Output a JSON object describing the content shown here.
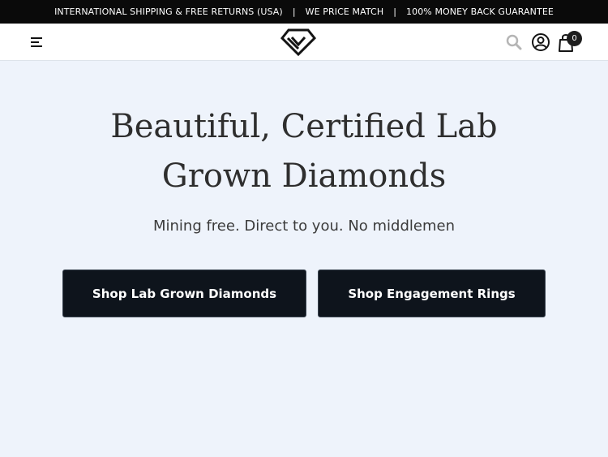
{
  "announcement": {
    "items": [
      "INTERNATIONAL SHIPPING & FREE RETURNS (USA)",
      "WE PRICE MATCH",
      "100% MONEY BACK GUARANTEE"
    ],
    "separator": "|"
  },
  "header": {
    "menu_icon": "hamburger-menu-icon",
    "logo_icon": "diamond-logo-icon",
    "search_icon": "search-icon",
    "account_icon": "account-user-icon",
    "cart_icon": "shopping-bag-icon",
    "cart_count": "0"
  },
  "hero": {
    "title_line1": "Beautiful, Certified Lab",
    "title_line2": "Grown Diamonds",
    "subtitle": "Mining free. Direct to you. No middlemen",
    "primary_cta": "Shop Lab Grown Diamonds",
    "secondary_cta": "Shop Engagement Rings"
  },
  "colors": {
    "announcement_bg": "#0a0a0a",
    "header_bg": "#ffffff",
    "page_bg": "#eef3fb",
    "button_bg": "#0e141c",
    "button_text": "#ffffff",
    "heading_text": "#2e2e2e"
  }
}
